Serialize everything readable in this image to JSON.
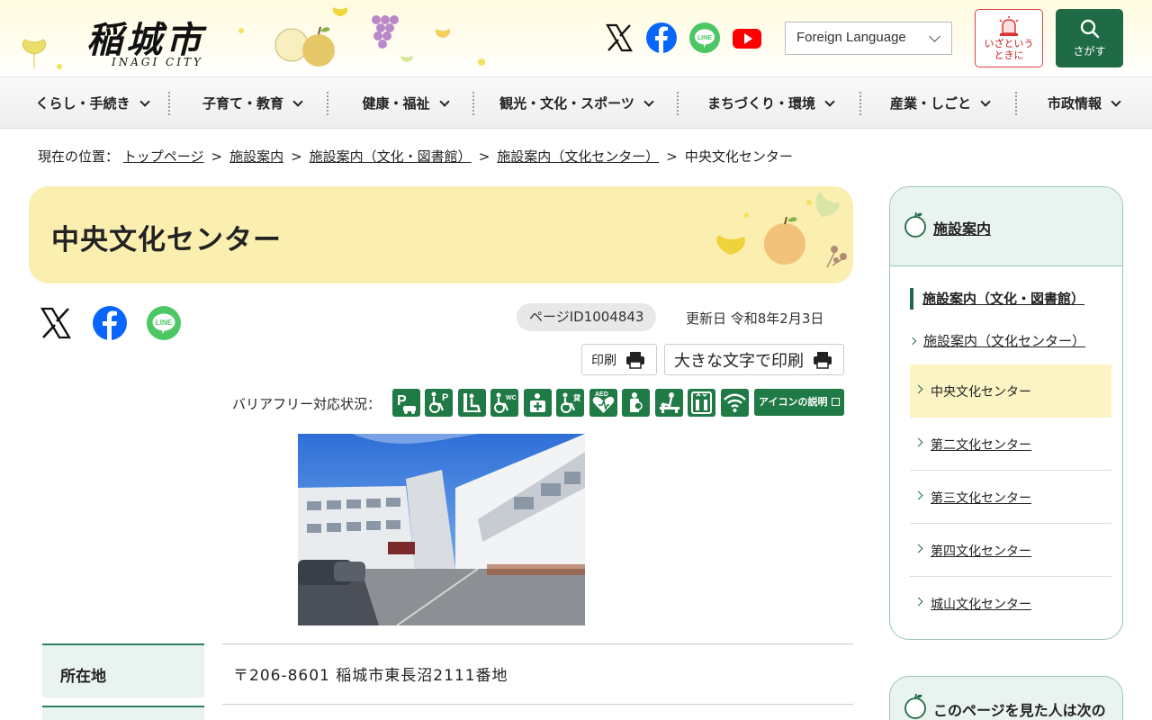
{
  "header": {
    "logo_text": "稲城市",
    "logo_subtext": "INAGI CITY",
    "sns": [
      "x-icon",
      "facebook-icon",
      "line-icon",
      "youtube-icon"
    ],
    "line_label": "LINE",
    "language_label": "Foreign Language",
    "emergency_label_line1": "いざという",
    "emergency_label_line2": "ときに",
    "search_label": "さがす"
  },
  "nav": {
    "items": [
      {
        "label": "くらし・手続き"
      },
      {
        "label": "子育て・教育"
      },
      {
        "label": "健康・福祉"
      },
      {
        "label": "観光・文化・スポーツ"
      },
      {
        "label": "まちづくり・環境"
      },
      {
        "label": "産業・しごと"
      },
      {
        "label": "市政情報"
      }
    ]
  },
  "breadcrumb": {
    "prefix": "現在の位置：",
    "links": [
      "トップページ",
      "施設案内",
      "施設案内（文化・図書館）",
      "施設案内（文化センター）"
    ],
    "current": "中央文化センター",
    "separator": ">"
  },
  "page": {
    "title": "中央文化センター",
    "page_id": "ページID1004843",
    "updated": "更新日 令和8年2月3日",
    "print_label": "印刷",
    "print_large_label": "大きな文字で印刷",
    "barrier_free_label": "バリアフリー対応状況：",
    "barrier_free_icons": [
      "parking-icon",
      "accessible-parking-icon",
      "nursing-chair-icon",
      "accessible-toilet-icon",
      "first-aid-room-icon",
      "wheelchair-rental-icon",
      "aed-icon",
      "nursing-room-icon",
      "diaper-changing-icon",
      "elevator-icon",
      "wifi-icon"
    ],
    "icon_explain_label": "アイコンの説明",
    "aed_text": "AED",
    "wc_text": "WC",
    "rent_text": "貸",
    "table": {
      "address_label": "所在地",
      "address_value": "〒206-8601 稲城市東長沼2111番地"
    }
  },
  "sidebar": {
    "title": "施設案内",
    "level1": "施設案内（文化・図書館）",
    "level2": "施設案内（文化センター）",
    "items": [
      {
        "label": "中央文化センター",
        "active": true
      },
      {
        "label": "第二文化センター",
        "active": false
      },
      {
        "label": "第三文化センター",
        "active": false
      },
      {
        "label": "第四文化センター",
        "active": false
      },
      {
        "label": "城山文化センター",
        "active": false
      }
    ],
    "box2_title": "このページを見た人は次の"
  },
  "colors": {
    "accent_green": "#1f6b45",
    "title_banner": "#fbefb0",
    "sidebar_head": "#e9f3f0",
    "emergency_red": "#c81e1e"
  }
}
